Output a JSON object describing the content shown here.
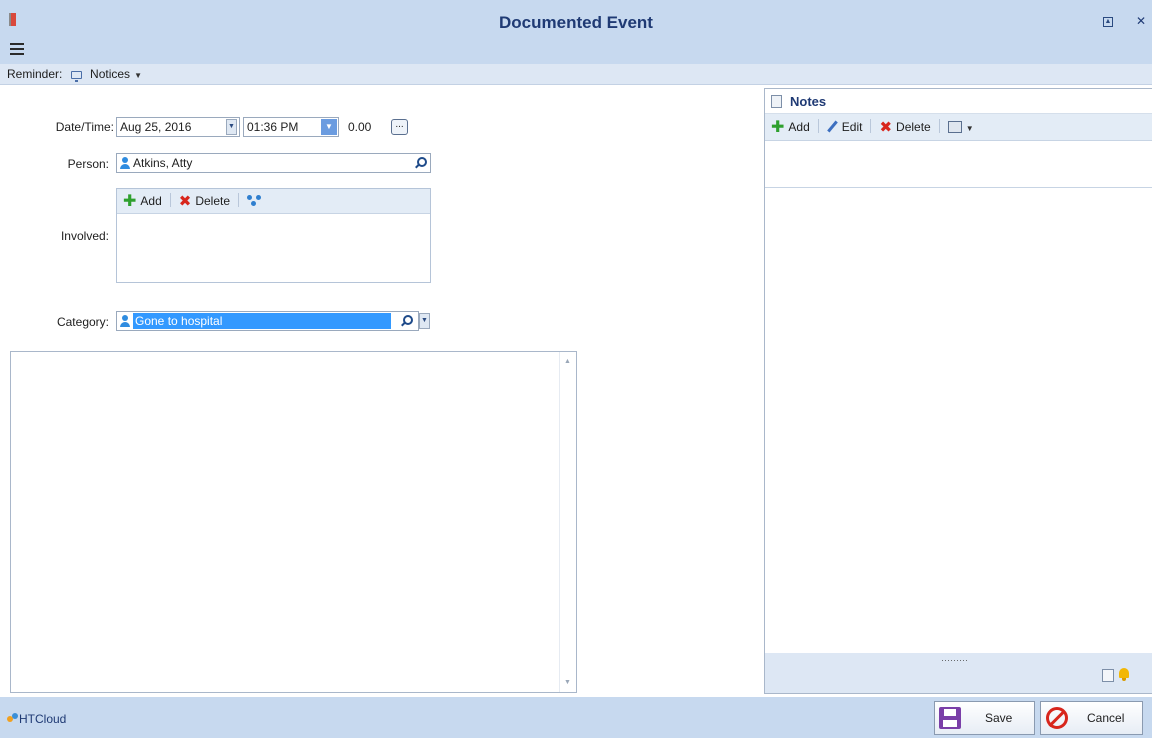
{
  "window": {
    "title": "Documented Event"
  },
  "reminder_bar": {
    "label": "Reminder:",
    "notices_label": "Notices"
  },
  "form": {
    "datetime": {
      "label": "Date/Time:",
      "date": "Aug 25, 2016",
      "time": "01:36 PM",
      "duration": "0.00",
      "ellipsis": "..."
    },
    "person": {
      "label": "Person:",
      "value": "Atkins, Atty"
    },
    "involved": {
      "label": "Involved:",
      "toolbar": {
        "add_label": "Add",
        "delete_label": "Delete"
      }
    },
    "category": {
      "label": "Category:",
      "value": "Gone to hospital"
    }
  },
  "notes": {
    "title": "Notes",
    "toolbar": {
      "add_label": "Add",
      "edit_label": "Edit",
      "delete_label": "Delete"
    }
  },
  "footer": {
    "brand": "HTCloud",
    "save_label": "Save",
    "cancel_label": "Cancel"
  },
  "colors": {
    "titlebar": "#c7d9ef",
    "title_text": "#1f3a74",
    "selection": "#3399ff",
    "add_icon": "#2ea02e",
    "delete_icon": "#d8261c",
    "save_icon": "#7a3fa8"
  }
}
